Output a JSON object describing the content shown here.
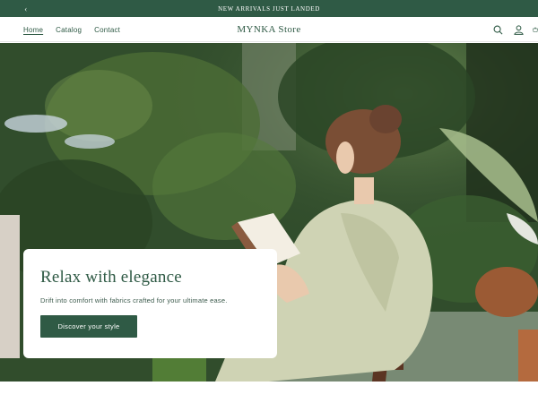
{
  "announcement": {
    "text": "NEW ARRIVALS JUST LANDED",
    "prev_icon": "chevron-left-icon"
  },
  "header": {
    "brand": "MYNKA Store",
    "nav": [
      {
        "label": "Home",
        "active": true
      },
      {
        "label": "Catalog",
        "active": false
      },
      {
        "label": "Contact",
        "active": false
      }
    ],
    "icons": [
      "search-icon",
      "account-icon",
      "cart-icon"
    ]
  },
  "hero": {
    "image": "woman-reading-book-in-garden-photo",
    "title": "Relax with elegance",
    "subtitle": "Drift into comfort with fabrics crafted for your ultimate ease.",
    "cta_label": "Discover your style"
  },
  "colors": {
    "brand_green": "#2f5a45",
    "white": "#ffffff"
  }
}
